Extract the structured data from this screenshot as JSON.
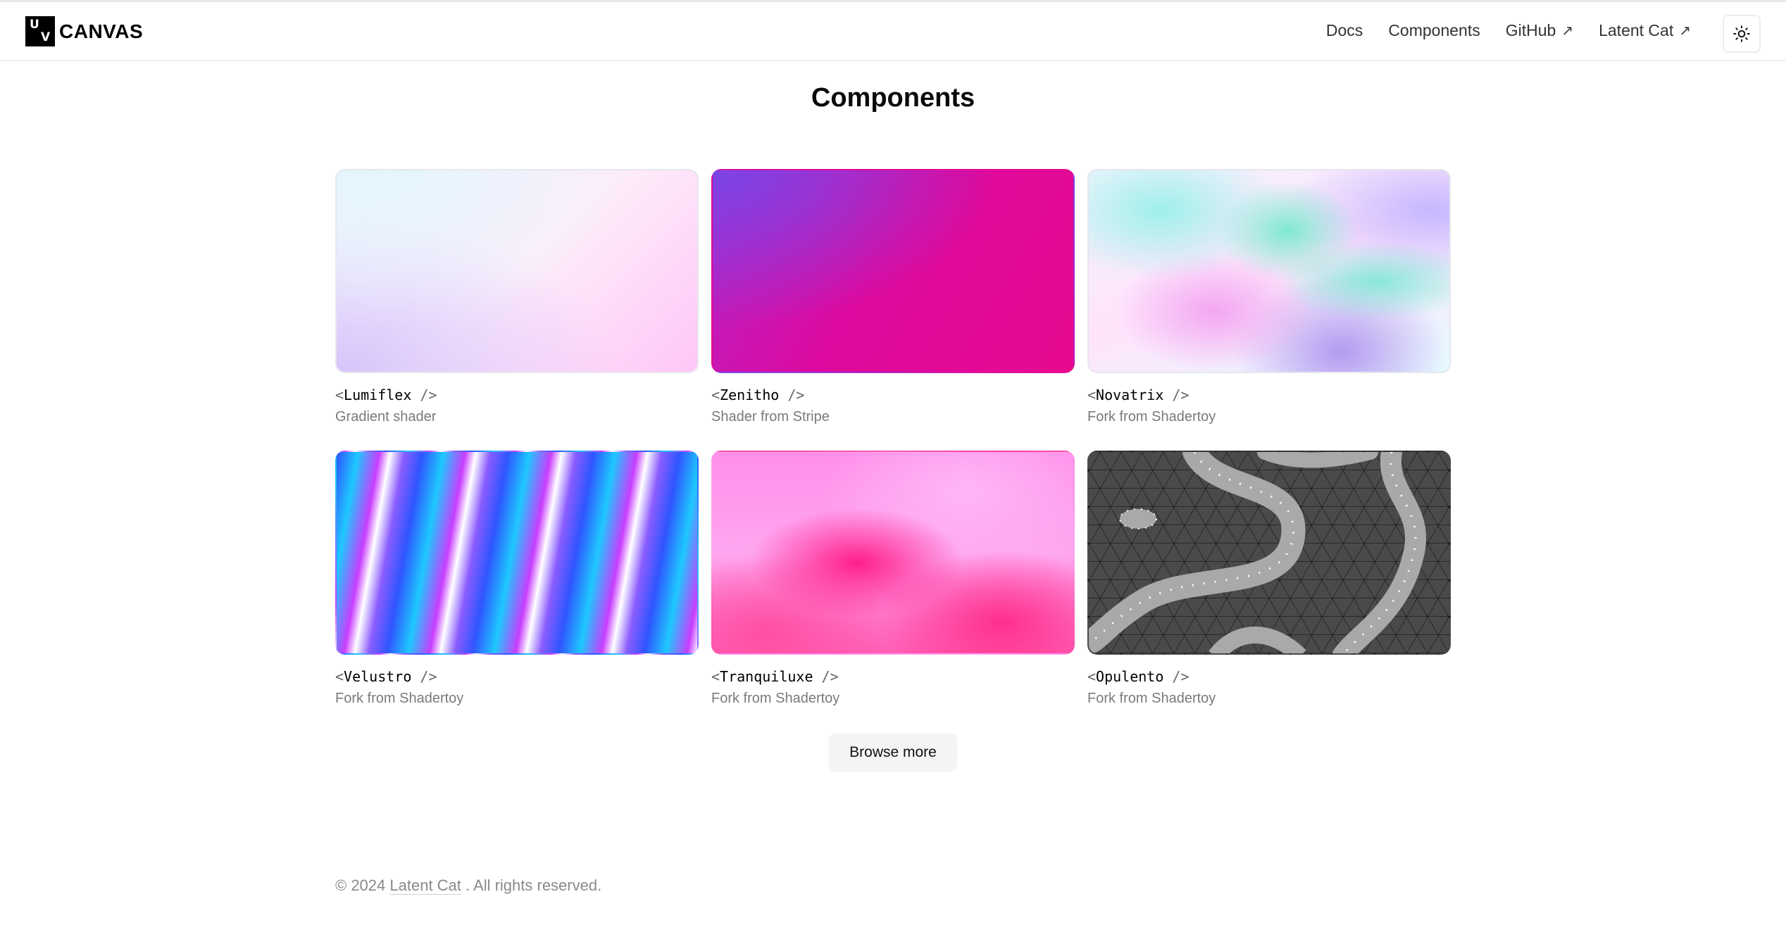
{
  "header": {
    "logo_u": "U",
    "logo_v": "V",
    "logo_text": "CANVAS",
    "nav": [
      {
        "label": "Docs",
        "external": false
      },
      {
        "label": "Components",
        "external": false
      },
      {
        "label": "GitHub",
        "external": true
      },
      {
        "label": "Latent Cat",
        "external": true
      }
    ],
    "external_icon": "↗",
    "theme_toggle_icon": "sun-icon"
  },
  "main": {
    "title": "Components",
    "cards": [
      {
        "name": "Lumiflex",
        "desc": "Gradient shader"
      },
      {
        "name": "Zenitho",
        "desc": "Shader from Stripe"
      },
      {
        "name": "Novatrix",
        "desc": "Fork from Shadertoy"
      },
      {
        "name": "Velustro",
        "desc": "Fork from Shadertoy"
      },
      {
        "name": "Tranquiluxe",
        "desc": "Fork from Shadertoy"
      },
      {
        "name": "Opulento",
        "desc": "Fork from Shadertoy"
      }
    ],
    "tag_open": "<",
    "tag_close": " />",
    "browse_label": "Browse more"
  },
  "footer": {
    "prefix": "© 2024 ",
    "link": "Latent Cat",
    "suffix": " . All rights reserved."
  }
}
